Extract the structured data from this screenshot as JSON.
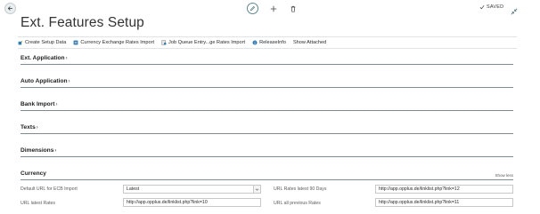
{
  "header": {
    "saved_label": "SAVED"
  },
  "page": {
    "title": "Ext. Features Setup"
  },
  "actions": [
    {
      "label": "Create Setup Data",
      "icon": "create-data-icon"
    },
    {
      "label": "Currency Exchange Rates Import",
      "icon": "exchange-rates-icon"
    },
    {
      "label": "Job Queue Entry...ge Rates Import",
      "icon": "job-queue-icon"
    },
    {
      "label": "ReleaseInfo",
      "icon": "info-icon"
    },
    {
      "label": "Show Attached",
      "icon": ""
    }
  ],
  "sections": {
    "ext_application": "Ext. Application",
    "auto_application": "Auto Application",
    "bank_import": "Bank Import",
    "texts": "Texts",
    "dimensions": "Dimensions",
    "currency": "Currency"
  },
  "currency": {
    "show_less": "Show less",
    "fields": {
      "default_url_label": "Default URL for ECB Import",
      "default_url_value": "Latest",
      "url_latest_label": "URL latest Rates",
      "url_latest_value": "http://app.opplus.de/linklist.php?link=10",
      "url_90_label": "URL Rates latest 90 Days",
      "url_90_value": "http://app.opplus.de/linklist.php?link=12",
      "url_all_label": "URL all previous Rates",
      "url_all_value": "http://app.opplus.de/linklist.php?link=11"
    }
  },
  "colors": {
    "accent": "#00807f",
    "divider": "#7f8b91"
  }
}
